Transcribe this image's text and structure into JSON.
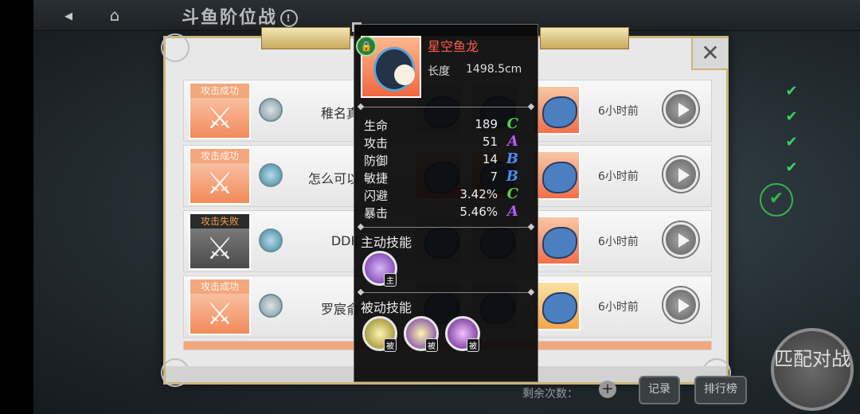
{
  "header": {
    "title": "斗鱼阶位战",
    "back_icon": "back-arrow-icon",
    "home_icon": "home-icon",
    "info_icon": "info-icon"
  },
  "records": [
    {
      "result": "攻击成功",
      "outcome": "win",
      "opponent": "稚名真",
      "time": "6小时前"
    },
    {
      "result": "攻击成功",
      "outcome": "win",
      "opponent": "怎么可以",
      "time": "6小时前"
    },
    {
      "result": "攻击失败",
      "outcome": "lose",
      "opponent": "DDK",
      "time": "6小时前"
    },
    {
      "result": "攻击成功",
      "outcome": "win",
      "opponent": "罗宸俞",
      "time": "6小时前"
    }
  ],
  "popup": {
    "fish_name": "星空鱼龙",
    "length_label": "长度",
    "length_value": "1498.5cm",
    "stats": [
      {
        "name": "生命",
        "value": "189",
        "grade": "C",
        "color": "#4fd14a"
      },
      {
        "name": "攻击",
        "value": "51",
        "grade": "A",
        "color": "#b45cf0"
      },
      {
        "name": "防御",
        "value": "14",
        "grade": "B",
        "color": "#4a8ef0"
      },
      {
        "name": "敏捷",
        "value": "7",
        "grade": "B",
        "color": "#4a8ef0"
      },
      {
        "name": "闪避",
        "value": "3.42%",
        "grade": "C",
        "color": "#4fd14a"
      },
      {
        "name": "暴击",
        "value": "5.46%",
        "grade": "A",
        "color": "#b45cf0"
      }
    ],
    "active_skill_label": "主动技能",
    "active_skill_tag": "主",
    "passive_skill_label": "被动技能",
    "passive_skill_tag": "被"
  },
  "bottom": {
    "remaining_label": "剩余次数：",
    "record_label": "记录",
    "rank_label": "排行榜",
    "match_label": "匹配对战"
  }
}
